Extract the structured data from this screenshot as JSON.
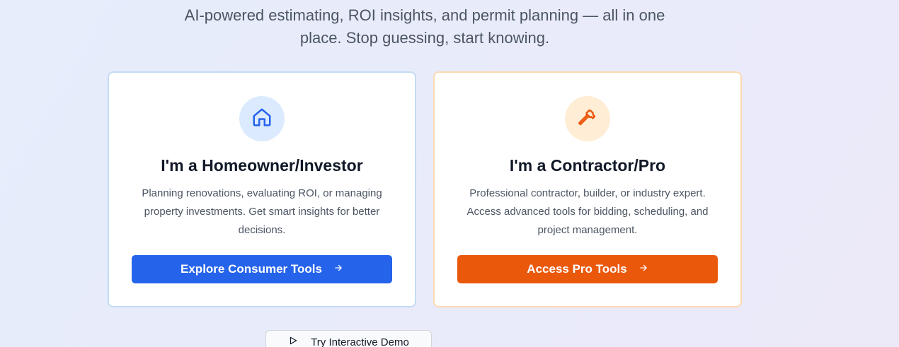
{
  "hero": {
    "subtitle_line1": "AI-powered estimating, ROI insights, and permit planning — all in one",
    "subtitle_line2": "place. Stop guessing, start knowing."
  },
  "cards": {
    "consumer": {
      "icon": "home-icon",
      "title": "I'm a Homeowner/Investor",
      "description": "Planning renovations, evaluating ROI, or managing property investments. Get smart insights for better decisions.",
      "button_label": "Explore Consumer Tools",
      "accent": "#2563eb"
    },
    "pro": {
      "icon": "hammer-icon",
      "title": "I'm a Contractor/Pro",
      "description": "Professional contractor, builder, or industry expert. Access advanced tools for bidding, scheduling, and project management.",
      "button_label": "Access Pro Tools",
      "accent": "#ea580c"
    }
  },
  "demo": {
    "icon": "play-icon",
    "label": "Try Interactive Demo"
  }
}
